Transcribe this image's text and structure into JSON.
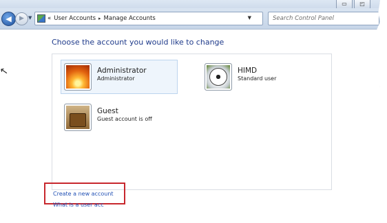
{
  "window": {
    "minimize_label": "▭",
    "restore_label": "◰"
  },
  "address": {
    "chevrons": "«",
    "crumbs": [
      "User Accounts",
      "Manage Accounts"
    ],
    "separator": "▸",
    "search_placeholder": "Search Control Panel"
  },
  "page": {
    "heading": "Choose the account you would like to change",
    "accounts": [
      {
        "name": "Administrator",
        "subtitle": "Administrator",
        "picture": "flower-icon"
      },
      {
        "name": "HIMD",
        "subtitle": "Standard user",
        "picture": "soccer-ball-icon"
      },
      {
        "name": "Guest",
        "subtitle": "Guest account is off",
        "picture": "suitcase-icon"
      }
    ],
    "create_link": "Create a new account",
    "whatis_link": "What is a user acc"
  },
  "colors": {
    "heading": "#1e3a8a",
    "link": "#1f4fb4",
    "highlight_box": "#c7262c",
    "selected_bg": "#eef5fc"
  }
}
